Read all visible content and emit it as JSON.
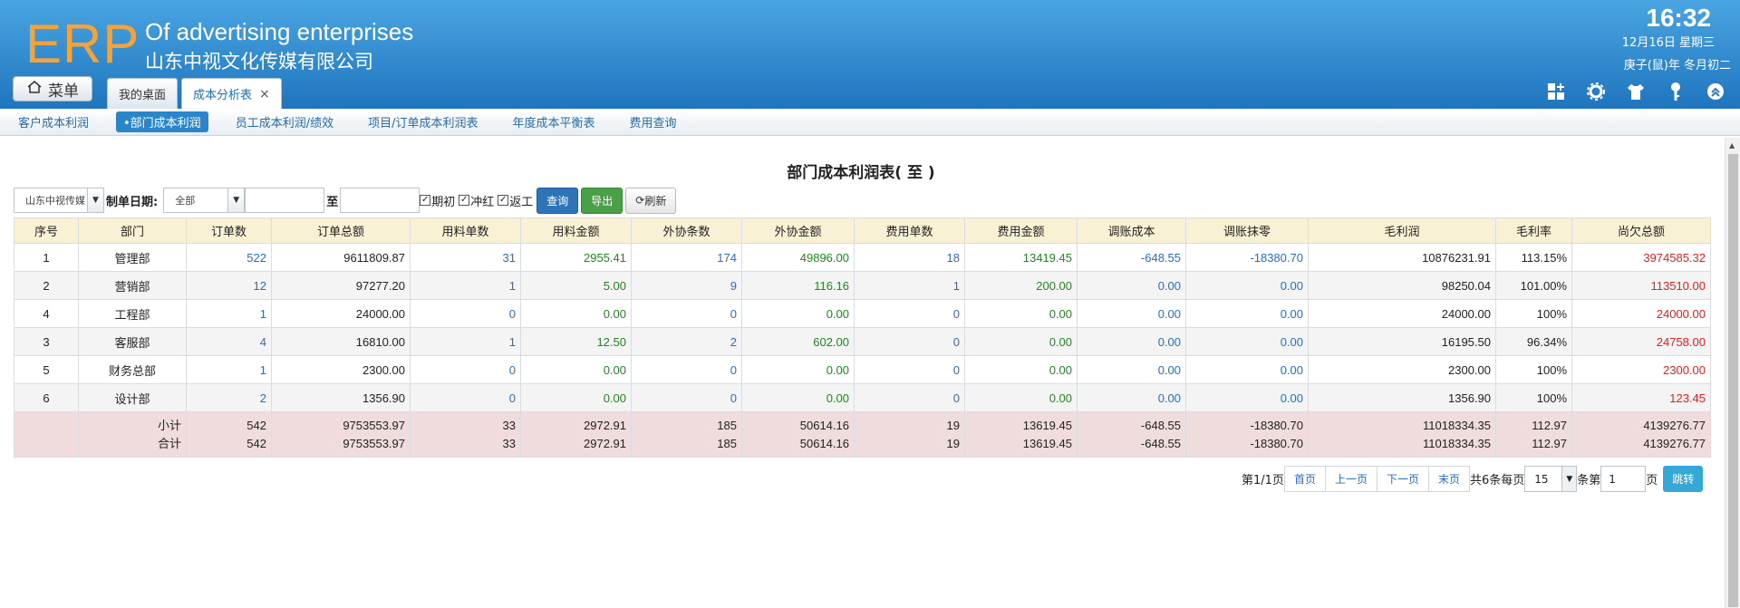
{
  "header": {
    "logo": "ERP",
    "brand_en": "Of advertising enterprises",
    "brand_cn": "山东中视文化传媒有限公司",
    "time": "16:32",
    "date": "12月16日 星期三",
    "lunar": "庚子(鼠)年 冬月初二",
    "menu_label": "菜单",
    "tabs": [
      {
        "label": "我的桌面"
      },
      {
        "label": "成本分析表",
        "close": "×"
      }
    ],
    "icons": [
      "grid-add-icon",
      "gear-icon",
      "shirt-icon",
      "key-icon",
      "collapse-icon"
    ]
  },
  "subnav": [
    {
      "label": "客户成本利润"
    },
    {
      "label": "•部门成本利润",
      "active": true
    },
    {
      "label": "员工成本利润/绩效"
    },
    {
      "label": "项目/订单成本利润表"
    },
    {
      "label": "年度成本平衡表"
    },
    {
      "label": "费用查询"
    }
  ],
  "report": {
    "title": "部门成本利润表( 至 )"
  },
  "filters": {
    "company_select": "山东中视传媒",
    "date_label": "制单日期:",
    "date_select": "全部",
    "to_label": "至",
    "chk_initial": "期初",
    "chk_reverse": "冲红",
    "chk_rework": "返工",
    "query_btn": "查询",
    "export_btn": "导出",
    "refresh_btn": "刷新"
  },
  "table": {
    "headers": [
      "序号",
      "部门",
      "订单数",
      "订单总额",
      "用料单数",
      "用料金额",
      "外协条数",
      "外协金额",
      "费用单数",
      "费用金额",
      "调账成本",
      "调账抹零",
      "毛利润",
      "毛利率",
      "尚欠总额"
    ],
    "rows": [
      [
        "1",
        "管理部",
        "522",
        "9611809.87",
        "31",
        "2955.41",
        "174",
        "49896.00",
        "18",
        "13419.45",
        "-648.55",
        "-18380.70",
        "10876231.91",
        "113.15%",
        "3974585.32"
      ],
      [
        "2",
        "营销部",
        "12",
        "97277.20",
        "1",
        "5.00",
        "9",
        "116.16",
        "1",
        "200.00",
        "0.00",
        "0.00",
        "98250.04",
        "101.00%",
        "113510.00"
      ],
      [
        "4",
        "工程部",
        "1",
        "24000.00",
        "0",
        "0.00",
        "0",
        "0.00",
        "0",
        "0.00",
        "0.00",
        "0.00",
        "24000.00",
        "100%",
        "24000.00"
      ],
      [
        "3",
        "客服部",
        "4",
        "16810.00",
        "1",
        "12.50",
        "2",
        "602.00",
        "0",
        "0.00",
        "0.00",
        "0.00",
        "16195.50",
        "96.34%",
        "24758.00"
      ],
      [
        "5",
        "财务总部",
        "1",
        "2300.00",
        "0",
        "0.00",
        "0",
        "0.00",
        "0",
        "0.00",
        "0.00",
        "0.00",
        "2300.00",
        "100%",
        "2300.00"
      ],
      [
        "6",
        "设计部",
        "2",
        "1356.90",
        "0",
        "0.00",
        "0",
        "0.00",
        "0",
        "0.00",
        "0.00",
        "0.00",
        "1356.90",
        "100%",
        "123.45"
      ]
    ],
    "subtotal": [
      "小计",
      "542",
      "9753553.97",
      "33",
      "2972.91",
      "185",
      "50614.16",
      "19",
      "13619.45",
      "-648.55",
      "-18380.70",
      "11018334.35",
      "112.97",
      "4139276.77"
    ],
    "total": [
      "合计",
      "542",
      "9753553.97",
      "33",
      "2972.91",
      "185",
      "50614.16",
      "19",
      "13619.45",
      "-648.55",
      "-18380.70",
      "11018334.35",
      "112.97",
      "4139276.77"
    ]
  },
  "pager": {
    "page_info": "第1/1页",
    "first": "首页",
    "prev": "上一页",
    "next": "下一页",
    "last": "末页",
    "count_info": "共6条每页",
    "page_size": "15",
    "unit_label": "条第",
    "page_input": "1",
    "page_label": "页",
    "go": "跳转"
  },
  "colors": {
    "header_top": "#4aa5e2",
    "header_bottom": "#1f75be",
    "logo": "#f4a33a",
    "link_blue": "#2a6dc0",
    "money_green": "#1b8a1b",
    "debt_red": "#e01f1f",
    "summary_bg": "#f0dcdd"
  }
}
